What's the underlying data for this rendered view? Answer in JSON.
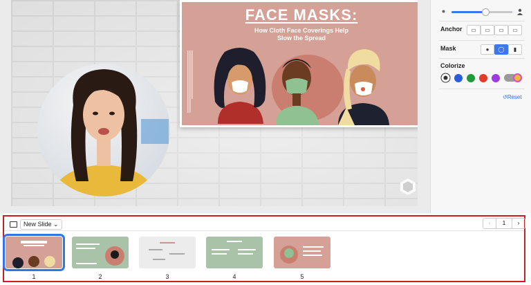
{
  "slide": {
    "title": "FACE MASKS:",
    "subtitle_line1": "How Cloth Face Coverings Help",
    "subtitle_line2": "Slow the Spread"
  },
  "panel": {
    "anchor_label": "Anchor",
    "mask_label": "Mask",
    "colorize_label": "Colorize",
    "reset_label": "Reset",
    "slider_value": 0.55,
    "swatches": [
      "#2b5bd8",
      "#1f9a3a",
      "#e23b2a",
      "#9c3be0"
    ],
    "colors": {
      "accent": "#3b78f0",
      "highlight": "#c91f1f"
    }
  },
  "bottom": {
    "new_slide_label": "New Slide",
    "page_number": "1",
    "thumbnails": [
      {
        "number": "1",
        "bg": "#d5a196",
        "selected": true
      },
      {
        "number": "2",
        "bg": "#a9c3a8",
        "selected": false
      },
      {
        "number": "3",
        "bg": "#ececec",
        "selected": false
      },
      {
        "number": "4",
        "bg": "#a9c3a8",
        "selected": false
      },
      {
        "number": "5",
        "bg": "#d5a196",
        "selected": false
      }
    ]
  },
  "icons": [
    "brightness-low-icon",
    "person-icon",
    "anchor-icon",
    "mask-person-icon",
    "mask-circle-icon",
    "mask-rect-icon",
    "color-none-icon",
    "color-wheel-icon",
    "reset-icon",
    "new-slide-icon",
    "chevron-down-icon",
    "chevron-left-icon",
    "chevron-right-icon",
    "app-logo-icon"
  ]
}
